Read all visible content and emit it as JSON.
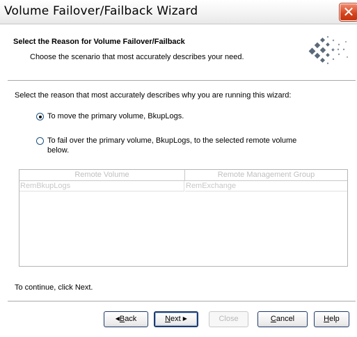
{
  "window": {
    "title": "Volume Failover/Failback Wizard",
    "close_glyph": "✕"
  },
  "header": {
    "title": "Select the Reason for Volume Failover/Failback",
    "subtitle": "Choose the scenario that most accurately describes your need.",
    "logo": "dot-diamond-logo"
  },
  "prompt": "Select the reason that most accurately describes why you are running this wizard:",
  "options": [
    {
      "label": "To move the primary volume, BkupLogs.",
      "checked": true
    },
    {
      "label_line1": "To fail over the primary volume, BkupLogs, to the selected remote volume",
      "label_line2": "below.",
      "checked": false
    }
  ],
  "table": {
    "columns": [
      "Remote Volume",
      "Remote Management Group"
    ],
    "rows": [
      [
        "RemBkupLogs",
        "RemExchange"
      ]
    ]
  },
  "footer_text": "To continue, click Next.",
  "buttons": {
    "back_mnemonic": "B",
    "back_rest": "ack",
    "back_arrow": "◀",
    "next_mnemonic": "N",
    "next_rest": "ext",
    "next_arrow": "▶",
    "close": "Close",
    "cancel_mnemonic": "C",
    "cancel_rest": "ancel",
    "help_mnemonic": "H",
    "help_rest": "elp"
  },
  "colors": {
    "close_button": "#d4441c",
    "logo_dark": "#5a6a7a"
  }
}
